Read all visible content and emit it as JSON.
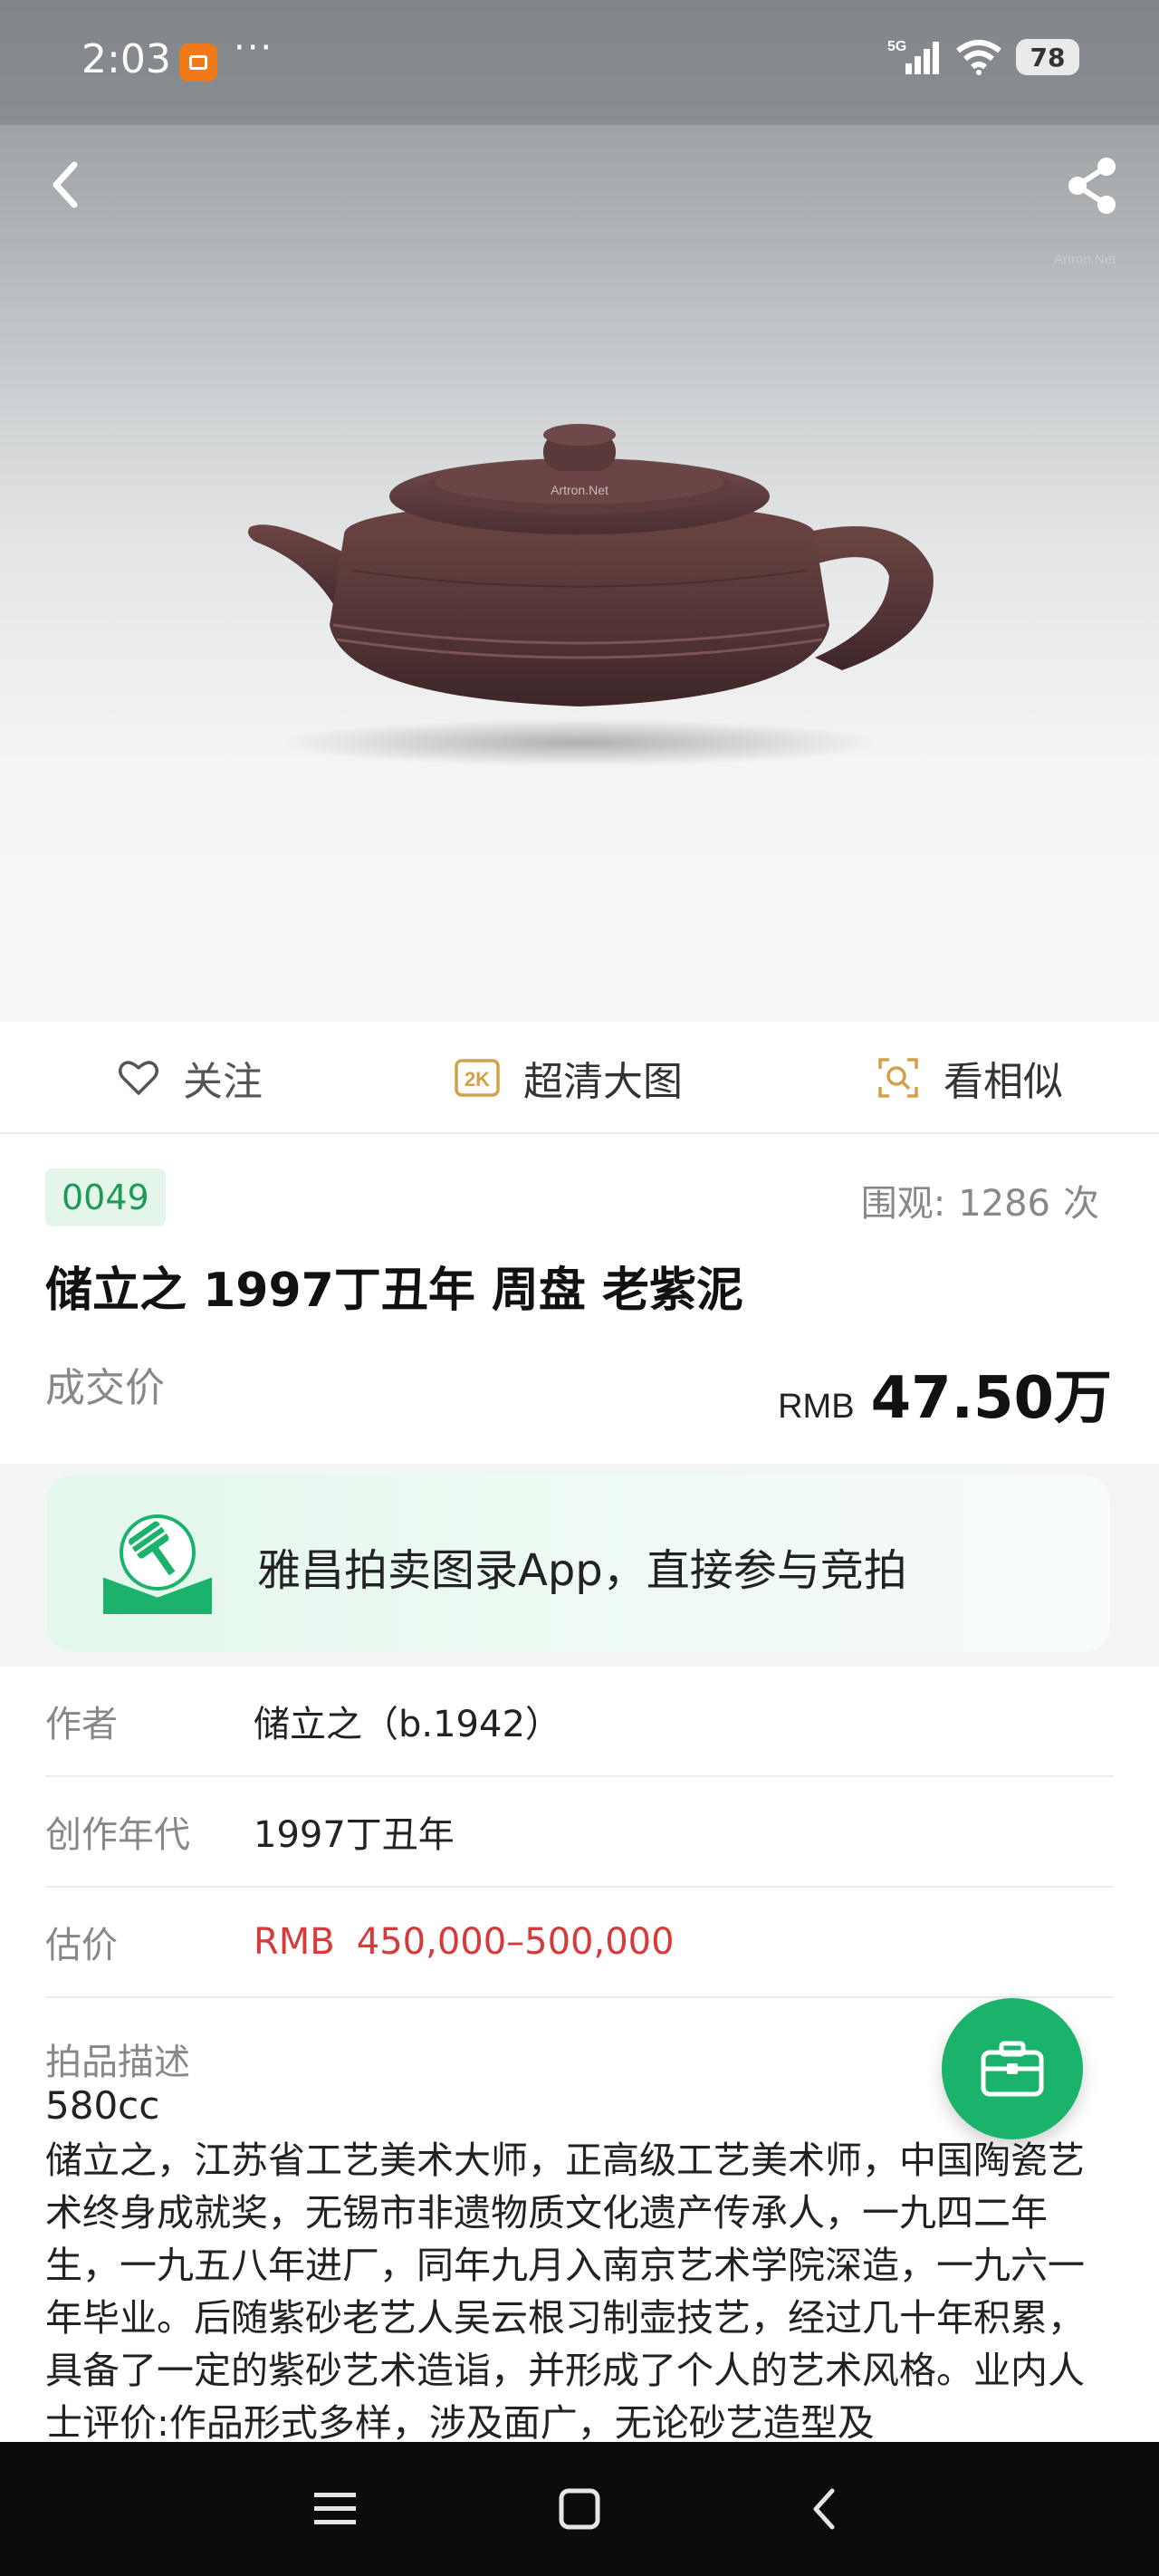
{
  "status_bar": {
    "time": "2:03",
    "more_dots": "···",
    "network": "5G",
    "battery": "78"
  },
  "hero": {
    "watermark": "Artron.Net",
    "lid_watermark": "Artron.Net"
  },
  "actions": {
    "follow": "关注",
    "hd_badge": "2K",
    "hd": "超清大图",
    "similar": "看相似"
  },
  "lot": {
    "number": "0049",
    "views_label": "围观:",
    "views_count": "1286",
    "views_unit": "次",
    "title": "储立之 1997丁丑年 周盘 老紫泥",
    "deal_label": "成交价",
    "deal_currency": "RMB",
    "deal_price": "47.50万"
  },
  "promo": {
    "text": "雅昌拍卖图录App，直接参与竞拍"
  },
  "details": {
    "author_label": "作者",
    "author_value": "储立之（b.1942）",
    "year_label": "创作年代",
    "year_value": "1997丁丑年",
    "estimate_label": "估价",
    "estimate_currency": "RMB",
    "estimate_value": "450,000–500,000",
    "description_label": "拍品描述",
    "description_size": "580cc",
    "description_text": "储立之，江苏省工艺美术大师，正高级工艺美术师，中国陶瓷艺术终身成就奖，无锡市非遗物质文化遗产传承人，一九四二年生，一九五八年进厂，同年九月入南京艺术学院深造，一九六一年毕业。后随紫砂老艺人吴云根习制壶技艺，经过几十年积累，具备了一定的紫砂艺术造诣，并形成了个人的艺术风格。业内人士评价:作品形式多样，涉及面广，无论砂艺造型及"
  },
  "colors": {
    "accent_green": "#1bb36b",
    "price_red": "#d73a3a",
    "badge_bg": "#e4f6ea"
  },
  "icons": [
    "back-icon",
    "share-icon",
    "heart-icon",
    "hd-2k-icon",
    "similar-scan-icon",
    "auction-hammer-logo",
    "briefcase-icon",
    "menu-icon",
    "home-icon",
    "back-nav-icon"
  ]
}
